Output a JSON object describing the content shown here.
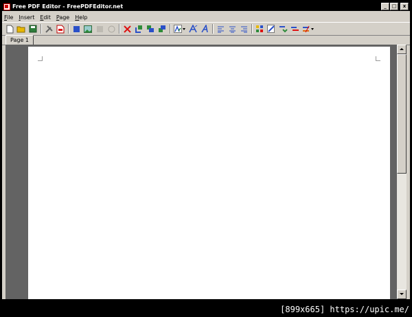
{
  "window": {
    "title": "Free PDF Editor - FreePDFEditor.net",
    "controls": {
      "minimize": "_",
      "maximize": "□",
      "close": "x"
    }
  },
  "menu": {
    "items": [
      {
        "hotkey": "F",
        "rest": "ile"
      },
      {
        "hotkey": "I",
        "rest": "nsert"
      },
      {
        "hotkey": "E",
        "rest": "dit"
      },
      {
        "hotkey": "P",
        "rest": "age"
      },
      {
        "hotkey": "H",
        "rest": "elp"
      }
    ]
  },
  "toolbar": {
    "colors": {
      "blue": "#2a50c8",
      "green": "#2e8b3a",
      "red": "#d11",
      "gray": "#9a9a9a",
      "yellow": "#e8b800",
      "orange": "#e06a10"
    }
  },
  "tabs": [
    {
      "label": "Page 1",
      "active": true
    }
  ],
  "overlay": {
    "text": "[899x665] https://upic.me/"
  }
}
